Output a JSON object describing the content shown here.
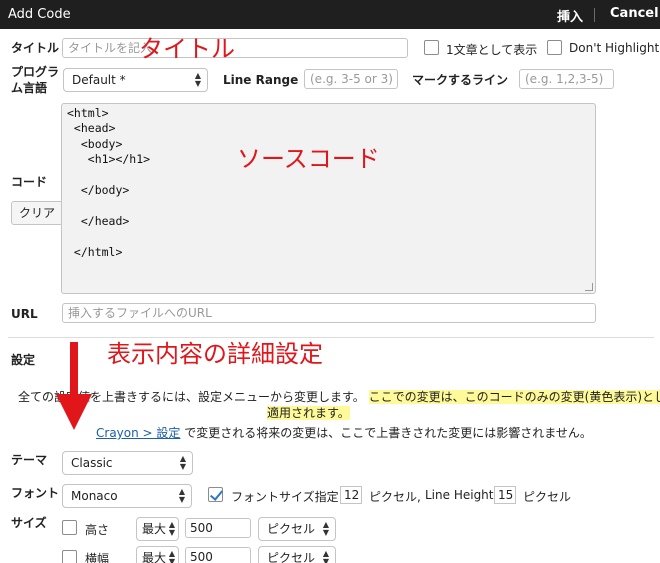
{
  "dialog": {
    "title": "Add Code",
    "insert_label": "挿入",
    "cancel_label": "Cancel"
  },
  "title_row": {
    "label": "タイトル",
    "placeholder": "タイトルを記入",
    "inline_label": "1文章として表示",
    "dont_highlight_label": "Don't Highlight"
  },
  "lang_row": {
    "label_line1": "プログラ",
    "label_line2": "ム言語",
    "language_value": "Default *",
    "line_range_label": "Line Range",
    "line_range_placeholder": "(e.g. 3-5 or 3)",
    "mark_lines_label": "マークするライン",
    "mark_lines_placeholder": "(e.g. 1,2,3-5)"
  },
  "code": {
    "label": "コード",
    "clear_label": "クリア",
    "content": "<html>\n <head>\n  <body>\n   <h1></h1>\n\n  </body>\n\n  </head>\n\n </html>"
  },
  "url": {
    "label": "URL",
    "placeholder": "挿入するファイルへのURL"
  },
  "settings": {
    "heading": "設定",
    "desc_prefix": "全ての設定値を上書きするには、設定メニューから変更します。",
    "desc_highlight_1": "ここでの変更は、このコードのみの変更(黄色表示)として",
    "desc_highlight_2": "適用されます。",
    "crayon_link": "Crayon > 設定",
    "crayon_suffix": "で変更される将来の変更は、ここで上書きされた変更には影響されません。"
  },
  "theme": {
    "label": "テーマ",
    "value": "Classic"
  },
  "font": {
    "label": "フォント",
    "value": "Monaco",
    "font_size_label": "フォントサイズ指定",
    "font_size_value": "12",
    "pixel_label": "ピクセル,",
    "line_height_label": "Line Height",
    "line_height_value": "15",
    "pixel_label_2": "ピクセル"
  },
  "size": {
    "label": "サイズ",
    "height_label": "高さ",
    "height_mode": "最大",
    "height_value": "500",
    "height_unit": "ピクセル",
    "width_label": "横幅",
    "width_mode": "最大",
    "width_value": "500",
    "width_unit": "ピクセル"
  },
  "annotations": {
    "title": "タイトル",
    "source_code": "ソースコード",
    "display_settings": "表示内容の詳細設定",
    "arrow_color": "#e0161b"
  }
}
